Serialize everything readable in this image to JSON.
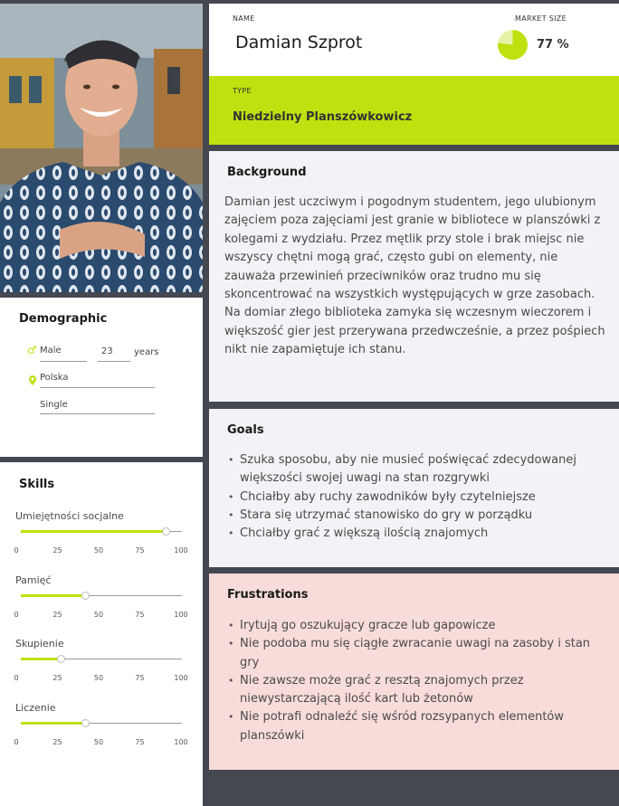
{
  "header": {
    "name_label": "NAME",
    "name": "Damian Szprot",
    "market_label": "MARKET SIZE",
    "market_value": "77 %",
    "market_percent": 77,
    "type_label": "TYPE",
    "type": "Niedzielny Planszówkowicz"
  },
  "demographic": {
    "title": "Demographic",
    "gender": "Male",
    "age": "23",
    "age_unit": "years",
    "location": "Polska",
    "status": "Single"
  },
  "skills": {
    "title": "Skills",
    "ticks": [
      "0",
      "25",
      "50",
      "75",
      "100"
    ],
    "items": [
      {
        "label": "Umiejętności socjalne",
        "value": 90
      },
      {
        "label": "Pamięć",
        "value": 40
      },
      {
        "label": "Skupienie",
        "value": 25
      },
      {
        "label": "Liczenie",
        "value": 40
      }
    ]
  },
  "background": {
    "title": "Background",
    "text": "Damian jest uczciwym i pogodnym studentem, jego ulubionym zajęciem poza zajęciami jest granie w bibliotece w planszówki z kolegami z wydziału. Przez mętlik przy stole i brak miejsc nie wszyscy chętni mogą grać, często gubi on elementy, nie zauważa przewinień przeciwników oraz trudno mu się skoncentrować na wszystkich występujących w grze zasobach. Na domiar złego biblioteka zamyka się wczesnym wieczorem i większość gier jest przerywana przedwcześnie, a przez pośpiech nikt nie zapamiętuje ich stanu."
  },
  "goals": {
    "title": "Goals",
    "items": [
      "Szuka sposobu, aby nie musieć poświęcać zdecydowanej większości swojej uwagi na stan rozgrywki",
      "Chciałby aby ruchy zawodników były czytelniejsze",
      "Stara się utrzymać stanowisko do gry w porządku",
      "Chciałby grać z większą ilością znajomych"
    ]
  },
  "frustrations": {
    "title": "Frustrations",
    "items": [
      "Irytują go oszukujący gracze lub gapowicze",
      "Nie podoba mu się ciągłe zwracanie uwagi na zasoby i stan gry",
      "Nie zawsze może grać z resztą znajomych przez niewystarczającą ilość kart lub żetonów",
      "Nie potrafi odnaleźć się wśród rozsypanych elementów planszówki"
    ]
  },
  "colors": {
    "accent": "#bde20f",
    "dark": "#454850",
    "card": "#f2f3f6",
    "frustrations": "#f8dcda"
  }
}
